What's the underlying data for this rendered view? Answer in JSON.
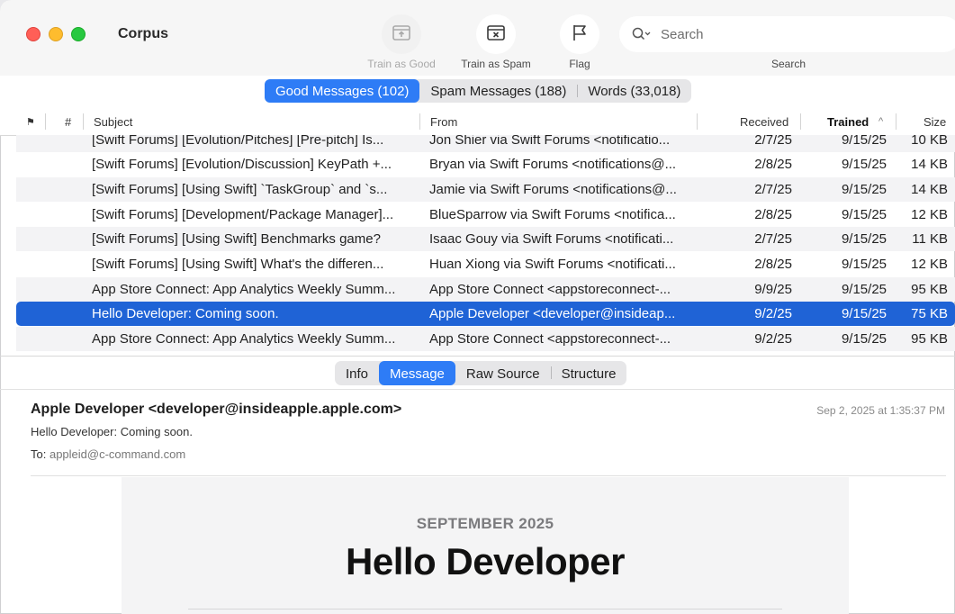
{
  "window": {
    "title": "Corpus"
  },
  "toolbar": {
    "train_good": "Train as Good",
    "train_spam": "Train as Spam",
    "flag": "Flag",
    "search_placeholder": "Search",
    "search_label": "Search"
  },
  "segments": {
    "good": "Good Messages (102)",
    "spam": "Spam Messages (188)",
    "words": "Words (33,018)"
  },
  "columns": {
    "flag": "⚑",
    "num": "#",
    "subject": "Subject",
    "from": "From",
    "received": "Received",
    "trained": "Trained",
    "size": "Size"
  },
  "rows": [
    {
      "subject": "[Swift Forums] [Evolution/Pitches] [Pre-pitch] Is...",
      "from": "Jon Shier via Swift Forums <notificatio...",
      "received": "2/7/25",
      "trained": "9/15/25",
      "size": "10 KB"
    },
    {
      "subject": "[Swift Forums] [Evolution/Discussion] KeyPath +...",
      "from": "Bryan via Swift Forums <notifications@...",
      "received": "2/8/25",
      "trained": "9/15/25",
      "size": "14 KB"
    },
    {
      "subject": "[Swift Forums] [Using Swift] `TaskGroup` and `s...",
      "from": "Jamie via Swift Forums <notifications@...",
      "received": "2/7/25",
      "trained": "9/15/25",
      "size": "14 KB"
    },
    {
      "subject": "[Swift Forums] [Development/Package Manager]...",
      "from": "BlueSparrow via Swift Forums <notifica...",
      "received": "2/8/25",
      "trained": "9/15/25",
      "size": "12 KB"
    },
    {
      "subject": "[Swift Forums] [Using Swift] Benchmarks game?",
      "from": "Isaac Gouy via Swift Forums <notificati...",
      "received": "2/7/25",
      "trained": "9/15/25",
      "size": "11 KB"
    },
    {
      "subject": "[Swift Forums] [Using Swift] What's the differen...",
      "from": "Huan Xiong via Swift Forums <notificati...",
      "received": "2/8/25",
      "trained": "9/15/25",
      "size": "12 KB"
    },
    {
      "subject": "App Store Connect: App Analytics Weekly Summ...",
      "from": "App Store Connect <appstoreconnect-...",
      "received": "9/9/25",
      "trained": "9/15/25",
      "size": "95 KB"
    },
    {
      "subject": "Hello Developer: Coming soon.",
      "from": "Apple Developer <developer@insideap...",
      "received": "9/2/25",
      "trained": "9/15/25",
      "size": "75 KB"
    },
    {
      "subject": "App Store Connect: App Analytics Weekly Summ...",
      "from": "App Store Connect <appstoreconnect-...",
      "received": "9/2/25",
      "trained": "9/15/25",
      "size": "95 KB"
    }
  ],
  "detail_tabs": {
    "info": "Info",
    "message": "Message",
    "raw": "Raw Source",
    "structure": "Structure"
  },
  "message": {
    "from": "Apple Developer <developer@insideapple.apple.com>",
    "date": "Sep 2, 2025 at 1:35:37 PM",
    "subject": "Hello Developer: Coming soon.",
    "to_label": "To:",
    "to": "appleid@c-command.com",
    "body_month": "SEPTEMBER 2025",
    "body_title": "Hello Developer"
  },
  "colors": {
    "accent": "#2e7cf6",
    "selection": "#1f63d6"
  }
}
